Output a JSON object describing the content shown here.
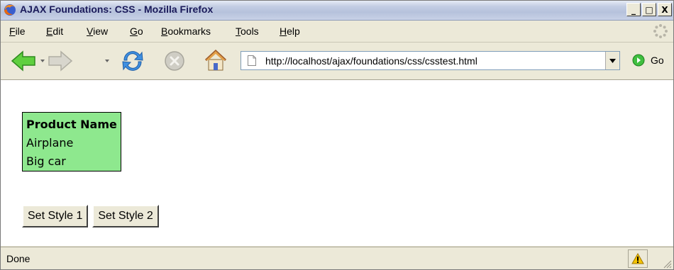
{
  "window": {
    "title": "AJAX Foundations: CSS - Mozilla Firefox",
    "controls": {
      "minimize": "_",
      "maximize": "□",
      "close": "X"
    }
  },
  "menu": [
    {
      "label": "File",
      "accel": "F",
      "rest": "ile"
    },
    {
      "label": "Edit",
      "accel": "E",
      "rest": "dit"
    },
    {
      "label": "View",
      "accel": "V",
      "rest": "iew"
    },
    {
      "label": "Go",
      "accel": "G",
      "rest": "o"
    },
    {
      "label": "Bookmarks",
      "accel": "B",
      "rest": "ookmarks"
    },
    {
      "label": "Tools",
      "accel": "T",
      "rest": "ools"
    },
    {
      "label": "Help",
      "accel": "H",
      "rest": "elp"
    }
  ],
  "toolbar": {
    "url": "http://localhost/ajax/foundations/css/csstest.html",
    "go_label": "Go",
    "icons": [
      "back-arrow-icon",
      "forward-arrow-icon",
      "reload-icon",
      "stop-icon",
      "home-icon"
    ]
  },
  "page": {
    "table": {
      "header": "Product Name",
      "rows": [
        "Airplane",
        "Big car"
      ],
      "background": "#8ee88e"
    },
    "buttons": [
      "Set Style 1",
      "Set Style 2"
    ]
  },
  "status": {
    "text": "Done"
  }
}
